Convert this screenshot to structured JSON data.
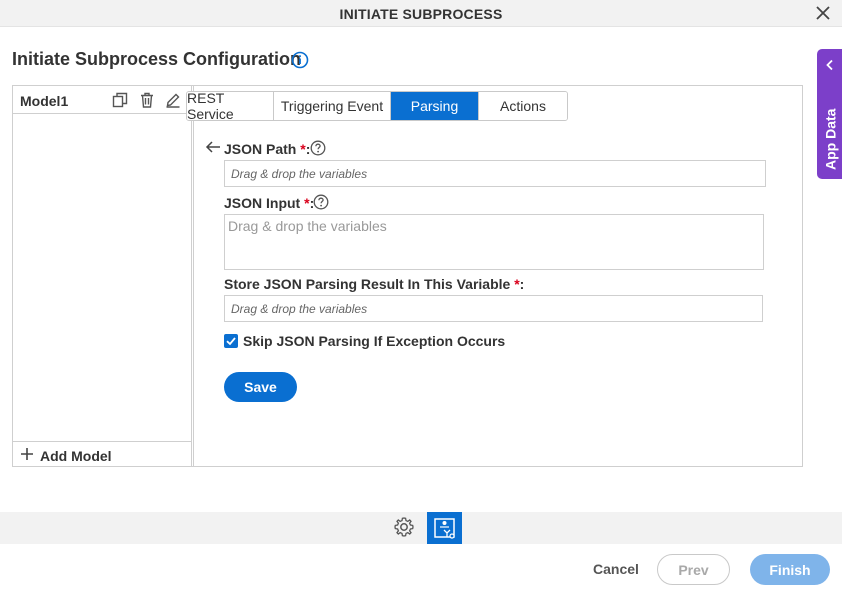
{
  "dialog": {
    "title": "INITIATE SUBPROCESS",
    "close_icon": "close-icon"
  },
  "page": {
    "heading": "Initiate Subprocess Configuration",
    "info_icon": "info-icon"
  },
  "models": {
    "items": [
      {
        "label": "Model1",
        "icons": [
          "copy-icon",
          "delete-icon",
          "edit-icon"
        ]
      }
    ],
    "add_label": "Add Model"
  },
  "tabs": [
    {
      "label": "REST Service",
      "active": false
    },
    {
      "label": "Triggering Event",
      "active": false
    },
    {
      "label": "Parsing",
      "active": true
    },
    {
      "label": "Actions",
      "active": false
    }
  ],
  "form": {
    "json_path": {
      "label": "JSON Path",
      "required_mark": "*",
      "suffix": ":",
      "placeholder": "Drag & drop the variables",
      "value": ""
    },
    "json_input": {
      "label": "JSON Input",
      "required_mark": "*",
      "suffix": ":",
      "placeholder": "Drag & drop the variables",
      "value": ""
    },
    "store_result": {
      "label": "Store JSON Parsing Result In This Variable",
      "required_mark": "*",
      "suffix": ":",
      "placeholder": "Drag & drop the variables",
      "value": ""
    },
    "skip_parsing": {
      "label": "Skip JSON Parsing If Exception Occurs",
      "checked": true
    },
    "save_label": "Save"
  },
  "side_panel": {
    "label": "App Data"
  },
  "footer": {
    "cancel_label": "Cancel",
    "prev_label": "Prev",
    "finish_label": "Finish"
  },
  "colors": {
    "accent": "#0a6fd1",
    "app_data_tab": "#7c3fc9",
    "required": "#d9001b",
    "finish_disabled": "#7fb4ea"
  }
}
